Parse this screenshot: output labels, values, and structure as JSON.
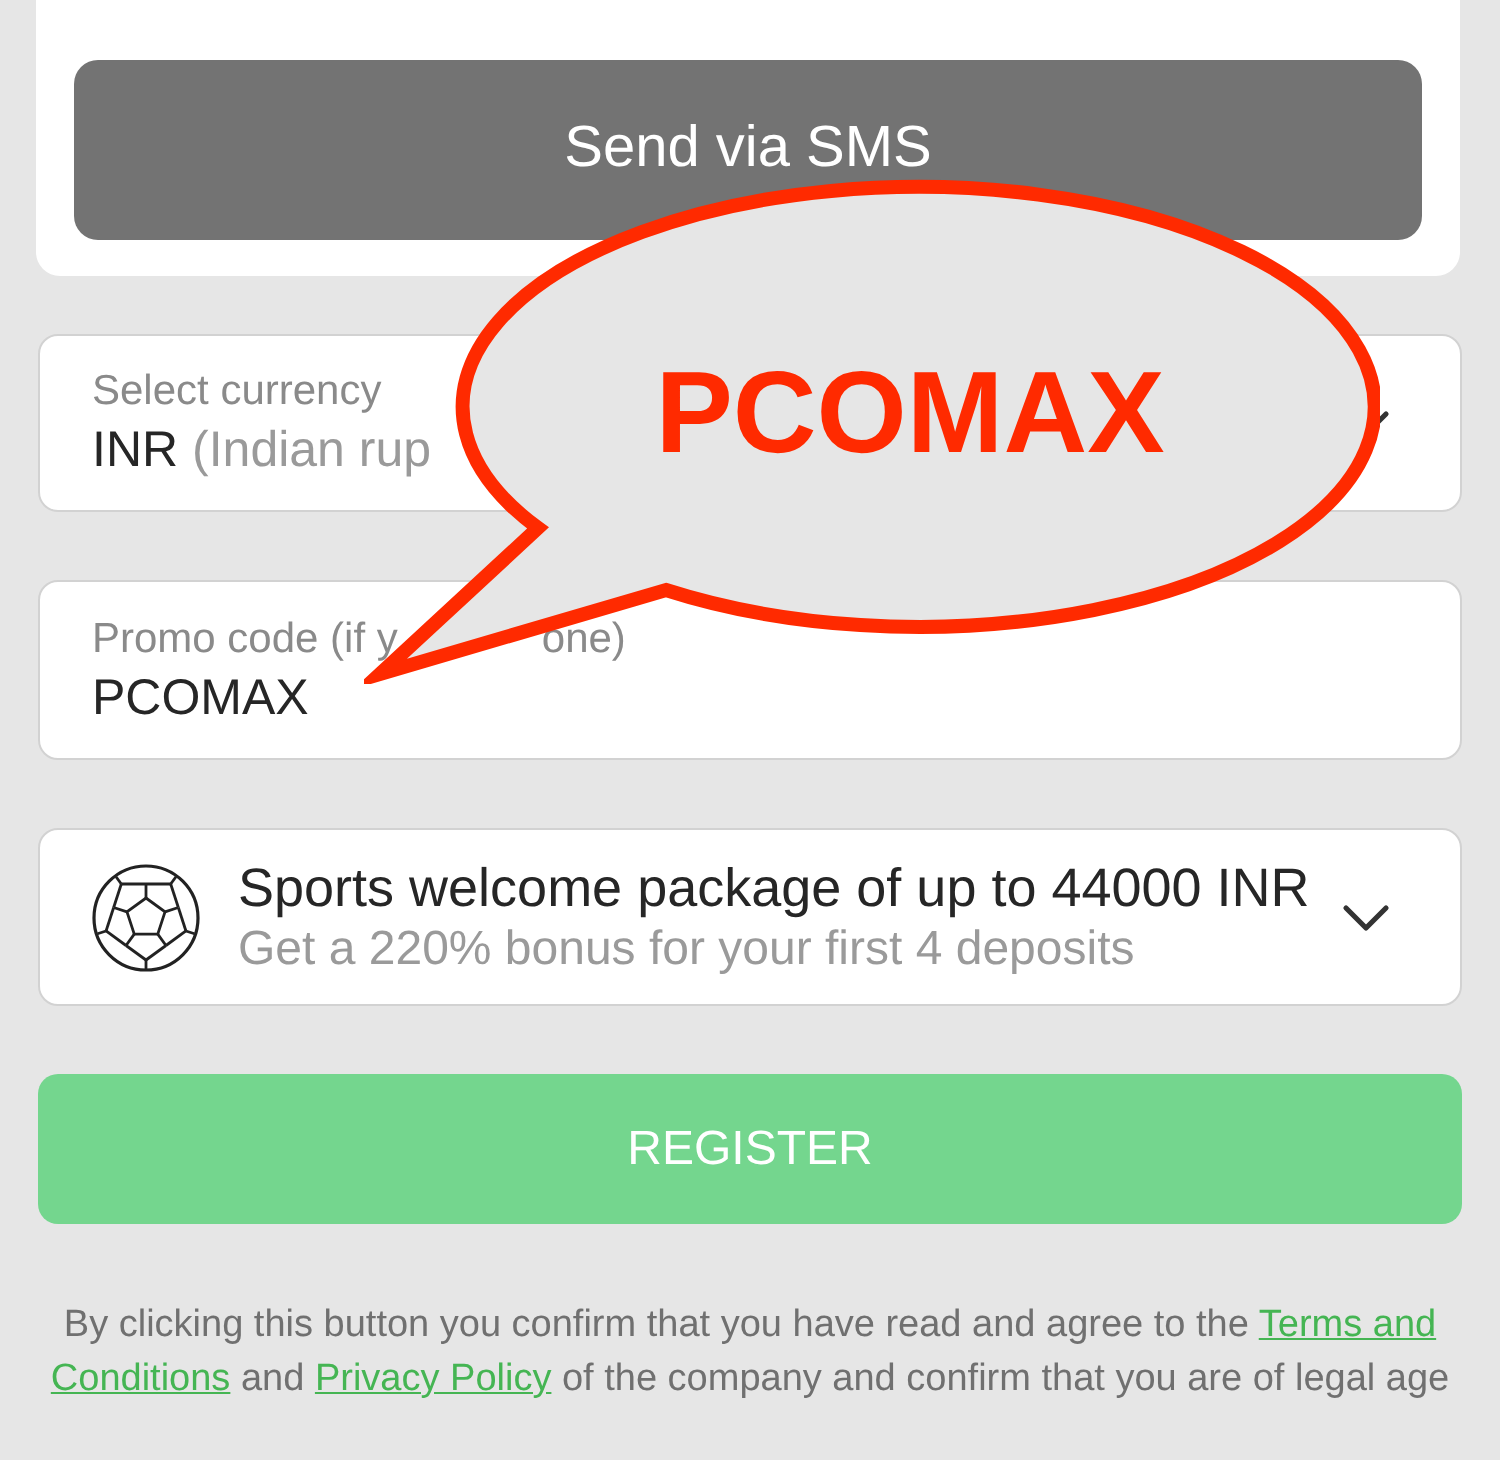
{
  "sms_button": {
    "label": "Send via SMS"
  },
  "currency_field": {
    "label": "Select currency",
    "value": "INR",
    "value_note": "(Indian rup"
  },
  "promo_field": {
    "label_parts": [
      "Promo code (if y",
      "one)"
    ],
    "value": "PCOMAX"
  },
  "bonus": {
    "title": "Sports welcome package of up to 44000 INR",
    "subtitle": "Get a 220% bonus for your first 4 deposits"
  },
  "register_button": {
    "label": "REGISTER"
  },
  "notice": [
    {
      "kind": "text",
      "text": "By clicking this button you confirm that you have read and agree to the"
    },
    {
      "kind": "link",
      "text": "Terms and"
    },
    {
      "kind": "link",
      "text": "Conditions"
    },
    {
      "kind": "text",
      "text": "and"
    },
    {
      "kind": "link",
      "text": "Privacy Policy"
    },
    {
      "kind": "text",
      "text": "of the company and confirm that you are of legal age"
    }
  ],
  "callout": {
    "text": "PCOMAX"
  }
}
